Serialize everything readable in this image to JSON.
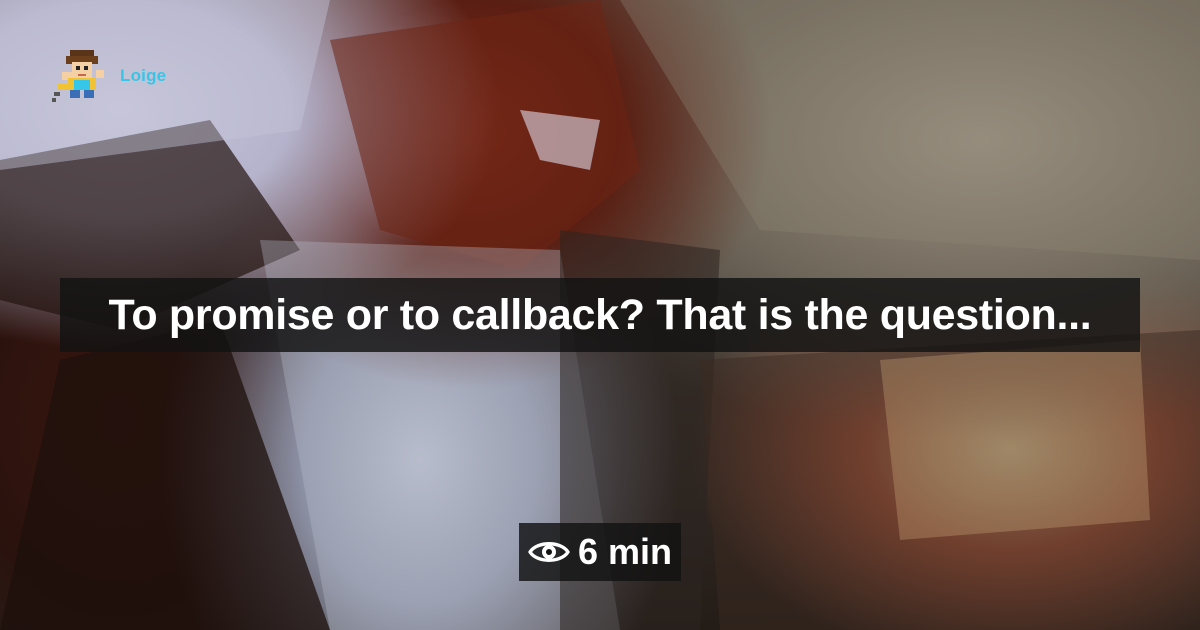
{
  "brand": {
    "name": "Loige",
    "color": "#35c6e8",
    "icon": "pixel-avatar-icon"
  },
  "post": {
    "title": "To promise or to callback? That is the question...",
    "reading_time": "6 min",
    "reading_time_icon": "eye-icon"
  },
  "colors": {
    "overlay": "#121212",
    "text": "#ffffff"
  }
}
